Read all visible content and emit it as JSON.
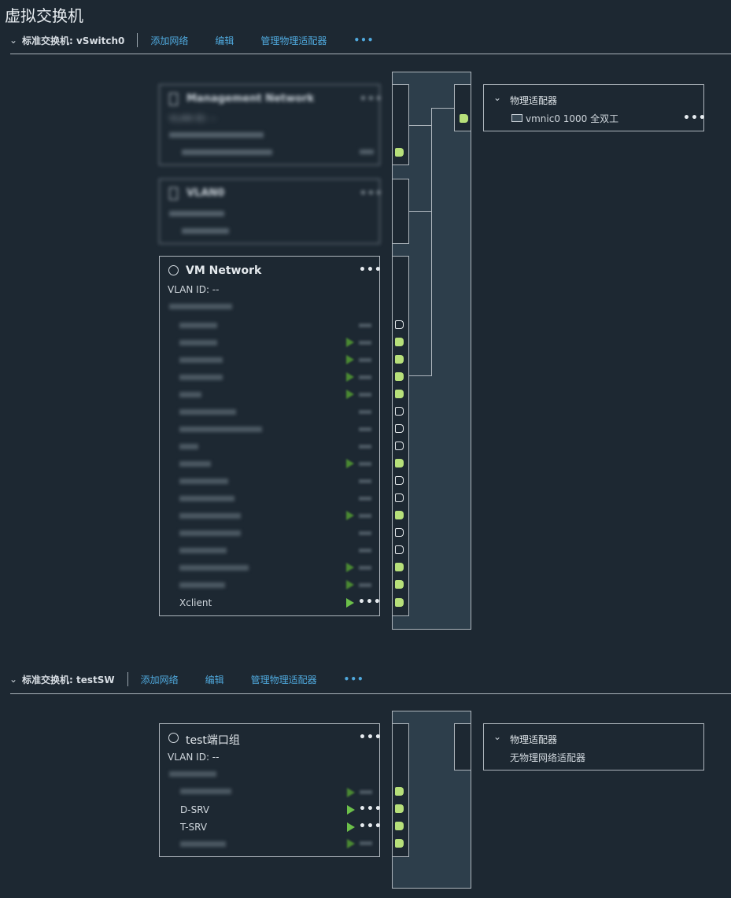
{
  "page_title": "虚拟交换机",
  "switches": [
    {
      "name": "标准交换机: vSwitch0",
      "actions": {
        "add_network": "添加网络",
        "edit": "编辑",
        "manage_adapters": "管理物理适配器",
        "more": "•••"
      },
      "port_groups": [
        {
          "title": "Management Network",
          "vlan": "VLAN ID: --",
          "blurred": true
        },
        {
          "title": "VLAN0",
          "blurred": true
        },
        {
          "title": "VM Network",
          "vlan": "VLAN ID: --",
          "more": "•••",
          "vms": [
            {
              "name": "Xclient",
              "powered_on": true
            }
          ]
        }
      ],
      "physical_adapters": {
        "title": "物理适配器",
        "items": [
          {
            "label": "vmnic0 1000 全双工",
            "more": "•••"
          }
        ]
      }
    },
    {
      "name": "标准交换机: testSW",
      "actions": {
        "add_network": "添加网络",
        "edit": "编辑",
        "manage_adapters": "管理物理适配器",
        "more": "•••"
      },
      "port_groups": [
        {
          "title": "test端口组",
          "vlan": "VLAN ID: --",
          "more": "•••",
          "vms": [
            {
              "name": "D-SRV",
              "powered_on": true,
              "more": "•••"
            },
            {
              "name": "T-SRV",
              "powered_on": true,
              "more": "•••"
            }
          ]
        }
      ],
      "physical_adapters": {
        "title": "物理适配器",
        "empty_text": "无物理网络适配器"
      }
    }
  ],
  "colors": {
    "background": "#1d2832",
    "link": "#4fa8dc",
    "port_on": "#b7e07a",
    "play": "#6cc04a",
    "column": "#2d3e4b"
  }
}
